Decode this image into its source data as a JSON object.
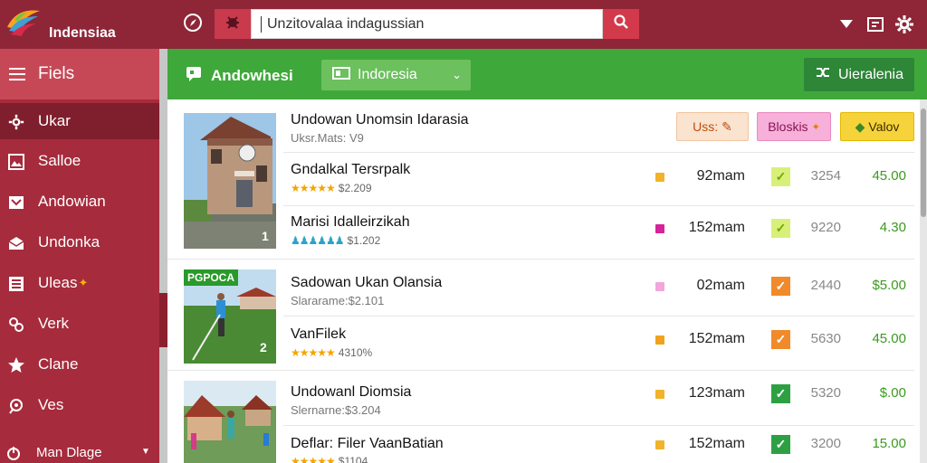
{
  "header": {
    "brand": "Indensiaa",
    "search_value": "Unzitovalaa indagussian",
    "icons": [
      "compass-icon",
      "bug-icon",
      "search-icon",
      "dropdown-triangle-icon",
      "export-icon",
      "gear-icon"
    ]
  },
  "sidebar": {
    "title": "Fiels",
    "items": [
      {
        "label": "Ukar",
        "icon": "gear-icon"
      },
      {
        "label": "Salloe",
        "icon": "image-icon"
      },
      {
        "label": "Andowian",
        "icon": "inbox-icon"
      },
      {
        "label": "Undonka",
        "icon": "mail-icon"
      },
      {
        "label": "Uleas",
        "icon": "list-icon"
      },
      {
        "label": "Verk",
        "icon": "link-icon"
      },
      {
        "label": "Clane",
        "icon": "star-icon"
      },
      {
        "label": "Ves",
        "icon": "pin-icon"
      }
    ],
    "footer": "Man Dlage"
  },
  "toolbar": {
    "title": "Andowhesi",
    "select_value": "Indoresia",
    "action_label": "Uieralenia"
  },
  "chips": [
    "Uss:",
    "Bloskis",
    "Valov"
  ],
  "rows": [
    {
      "title": "Undowan Unomsin Idarasia",
      "sub": "Uksr.Mats: V9",
      "meta": null,
      "stars": null
    },
    {
      "title": "Gndalkal Tersrpalk",
      "sub": null,
      "meta": "$2.209",
      "stars": "gold",
      "dur": "92mam",
      "mini_color": "#f0b32a",
      "check": "light",
      "num": "3254",
      "price": "45.00"
    },
    {
      "title": "Marisi Idalleirzikah",
      "sub": null,
      "meta": "$1.202",
      "stars": "blue",
      "dur": "152mam",
      "mini_color": "#d6239a",
      "check": "light",
      "num": "9220",
      "price": "4.30"
    },
    {
      "title": "Sadowan Ukan Olansia",
      "sub": "Slararame:$2.101",
      "meta": null,
      "stars": null,
      "dur": "02mam",
      "mini_color": "#f2a6dc",
      "check": "orange",
      "num": "2440",
      "price": "$5.00"
    },
    {
      "title": "VanFilek",
      "sub": null,
      "meta": "4310%",
      "stars": "gold",
      "dur": "152mam",
      "mini_color": "#f0a21c",
      "check": "orange",
      "num": "5630",
      "price": "45.00"
    },
    {
      "title": "Undowanl Diomsia",
      "sub": "Slernarne:$3.204",
      "meta": null,
      "stars": null,
      "dur": "123mam",
      "mini_color": "#f0b32a",
      "check": "green",
      "num": "5320",
      "price": "$.00"
    },
    {
      "title": "Deflar: Filer VaanBatian",
      "sub": null,
      "meta": "$1104",
      "stars": "gold",
      "dur": "152mam",
      "mini_color": "#f0b32a",
      "check": "green",
      "num": "3200",
      "price": "15.00"
    }
  ],
  "thumb_badge": "PGPOCA",
  "thumb_numbers": [
    "1",
    "2"
  ],
  "colors": {
    "header": "#8e2638",
    "sidebar": "#a62b3c",
    "toolbar_green": "#3fa83a",
    "price_green": "#3a9a1e"
  }
}
